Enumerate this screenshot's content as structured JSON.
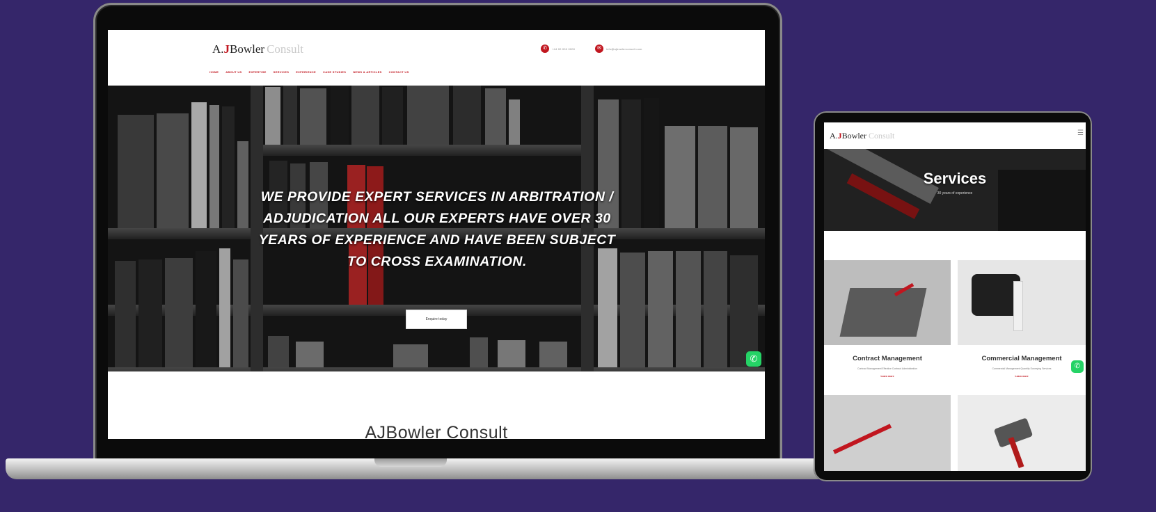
{
  "laptop": {
    "logo": {
      "a": "A.",
      "j": "J",
      "b": "Bowler",
      "c": "Consult"
    },
    "contacts": [
      {
        "icon": "phone-icon",
        "text": "+44 00 000 0000"
      },
      {
        "icon": "email-icon",
        "text": "info@ajbowlerconsult.com"
      }
    ],
    "nav": [
      "HOME",
      "ABOUT US",
      "EXPERTISE",
      "SERVICES",
      "EXPERIENCE",
      "CASE STUDIES",
      "NEWS & ARTICLES",
      "CONTACT US"
    ],
    "hero": {
      "headline": "WE PROVIDE EXPERT SERVICES IN ARBITRATION / ADJUDICATION ALL OUR EXPERTS HAVE OVER 30 YEARS OF EXPERIENCE AND HAVE BEEN SUBJECT TO CROSS EXAMINATION.",
      "button": "Enquire today"
    },
    "section_heading": "AJBowler Consult",
    "whatsapp_icon": "whatsapp-icon"
  },
  "tablet": {
    "logo": {
      "a": "A.",
      "j": "J",
      "b": "Bowler",
      "c": "Consult"
    },
    "hero": {
      "title": "Services",
      "subtitle": "30 years of experience"
    },
    "cards": [
      {
        "title": "Contract Management",
        "desc": "Contract Management Effective Contract Administration",
        "link": "Learn more"
      },
      {
        "title": "Commercial Management",
        "desc": "Commercial Management Quantity Surveying Services",
        "link": "Learn more"
      }
    ]
  },
  "colors": {
    "accent": "#c1161f",
    "background": "#35266a",
    "whatsapp": "#25d366"
  }
}
